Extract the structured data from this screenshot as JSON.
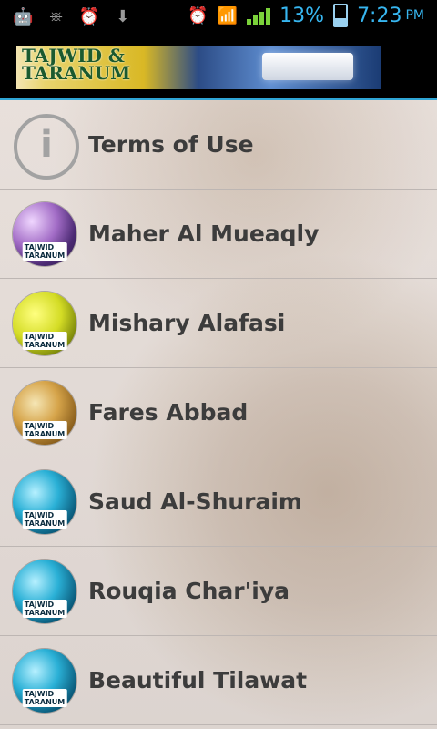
{
  "status_bar": {
    "battery_percent": "13%",
    "time": "7:23",
    "ampm": "PM",
    "left_icons": [
      "android-icon",
      "usb-icon",
      "alarm-icon",
      "download-icon"
    ],
    "right_icons": [
      "alarm-icon",
      "wifi-icon",
      "signal-icon",
      "battery-icon"
    ]
  },
  "header": {
    "brand_line1": "TAJWID &",
    "brand_line2": "TARANUM"
  },
  "list": {
    "items": [
      {
        "label": "Terms of Use",
        "icon": "info-icon",
        "badge": ""
      },
      {
        "label": "Maher Al Mueaqly",
        "icon": "reciter-avatar",
        "badge": "TAJWID TARANUM"
      },
      {
        "label": "Mishary Alafasi",
        "icon": "reciter-avatar",
        "badge": "TAJWID TARANUM"
      },
      {
        "label": "Fares Abbad",
        "icon": "reciter-avatar",
        "badge": "TAJWID TARANUM"
      },
      {
        "label": "Saud Al-Shuraim",
        "icon": "reciter-avatar",
        "badge": "TAJWID TARANUM"
      },
      {
        "label": "Rouqia Char'iya",
        "icon": "reciter-avatar",
        "badge": "TAJWID TARANUM"
      },
      {
        "label": "Beautiful Tilawat",
        "icon": "reciter-avatar",
        "badge": "TAJWID TARANUM"
      }
    ]
  },
  "colors": {
    "accent_blue": "#37b6f0",
    "divider_blue": "#2fa5d5",
    "text_dark": "#3c3c3c"
  }
}
